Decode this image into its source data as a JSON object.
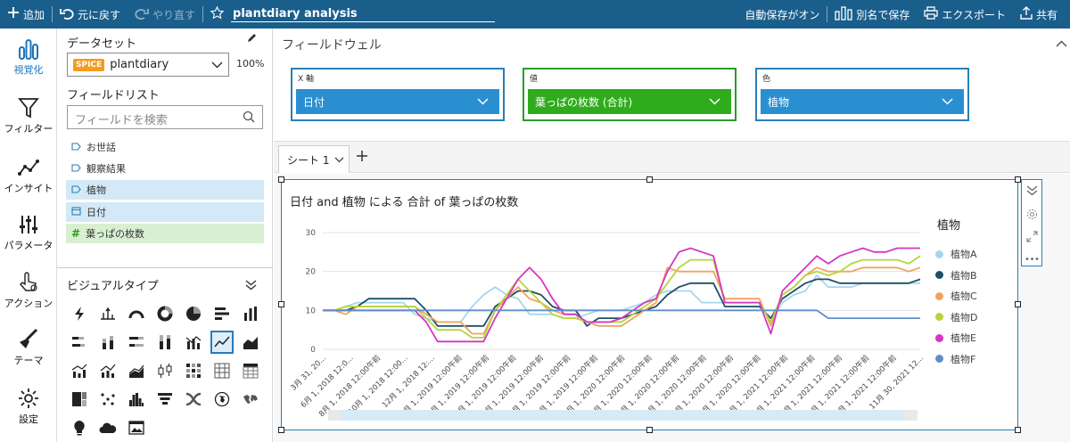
{
  "topbar": {
    "add_label": "追加",
    "undo_label": "元に戻す",
    "redo_label": "やり直す",
    "analysis_title": "plantdiary analysis",
    "autosave_label": "自動保存がオン",
    "save_as_label": "別名で保存",
    "export_label": "エクスポート",
    "share_label": "共有"
  },
  "rail": {
    "items": [
      {
        "label": "視覚化",
        "icon": "visualize-icon"
      },
      {
        "label": "フィルター",
        "icon": "filter-icon"
      },
      {
        "label": "インサイト",
        "icon": "insight-icon"
      },
      {
        "label": "パラメータ",
        "icon": "parameter-icon"
      },
      {
        "label": "アクション",
        "icon": "action-icon"
      },
      {
        "label": "テーマ",
        "icon": "theme-icon"
      },
      {
        "label": "設定",
        "icon": "settings-icon"
      }
    ]
  },
  "panel": {
    "dataset_heading": "データセット",
    "dataset_badge": "SPICE",
    "dataset_name": "plantdiary",
    "dataset_percent": "100%",
    "fieldlist_heading": "フィールドリスト",
    "search_placeholder": "フィールドを検索",
    "fields": [
      {
        "label": "お世話",
        "type": "dimension",
        "state": "none"
      },
      {
        "label": "観察結果",
        "type": "dimension",
        "state": "none"
      },
      {
        "label": "植物",
        "type": "dimension",
        "state": "selected"
      },
      {
        "label": "日付",
        "type": "date",
        "state": "selected"
      },
      {
        "label": "葉っぱの枚数",
        "type": "measure",
        "state": "measure-selected"
      }
    ],
    "visual_types_heading": "ビジュアルタイプ"
  },
  "field_wells": {
    "title": "フィールドウェル",
    "wells": [
      {
        "label": "X 軸",
        "value": "日付"
      },
      {
        "label": "値",
        "value": "葉っぱの枚数 (合計)"
      },
      {
        "label": "色",
        "value": "植物"
      }
    ]
  },
  "sheets": {
    "tabs": [
      {
        "label": "シート 1"
      }
    ]
  },
  "visual": {
    "title": "日付 and 植物 による 合計 of 葉っぱの枚数"
  },
  "chart_data": {
    "type": "line",
    "title": "日付 and 植物 による 合計 of 葉っぱの枚数",
    "legend_title": "植物",
    "legend_position": "right",
    "grid": "horizontal",
    "ylim": [
      0,
      30
    ],
    "yticks": [
      0,
      10,
      20,
      30
    ],
    "x_tick_labels": [
      "3月 31, 20...",
      "6月 1, 2018 12:0...",
      "8月 1, 2018 12:00午前",
      "10月 1, 2018 12:00...",
      "12月 1, 2018 12:...",
      "2月 1, 2019 12:00午前",
      "4月 1, 2019 12:00午前",
      "6月 1, 2019 12:00午前",
      "8月 1, 2019 12:00午前",
      "10月 1, 2019 12:00午前",
      "12月 1, 2019 12:00午前",
      "2月 1, 2020 12:00午前",
      "4月 1, 2020 12:00午前",
      "6月 1, 2020 12:00午前",
      "8月 1, 2020 12:00午前",
      "10月 1, 2020 12:00午前",
      "12月 1, 2020 12:00午前",
      "2月 1, 2021 12:00午前",
      "4月 1, 2021 12:00午前",
      "6月 1, 2021 12:00午前",
      "8月 1, 2021 12:00午前",
      "10月 1, 2021 12:00午前",
      "11月 30, 2021 12..."
    ],
    "series": [
      {
        "name": "植物A",
        "color": "#a6d6ec",
        "values": [
          10,
          10,
          11,
          12,
          12,
          12,
          12,
          12,
          9,
          8,
          7,
          7,
          7,
          11,
          14,
          16,
          14,
          13,
          9,
          9,
          9,
          8,
          8,
          9,
          10,
          10,
          10,
          11,
          12,
          14,
          15,
          15,
          15,
          12,
          12,
          12,
          12,
          12,
          12,
          7,
          12,
          14,
          15,
          19,
          16,
          16,
          16,
          17,
          17,
          17,
          17,
          17,
          17
        ]
      },
      {
        "name": "植物B",
        "color": "#1f4e66",
        "values": [
          10,
          10,
          10,
          11,
          13,
          13,
          13,
          13,
          13,
          10,
          6,
          6,
          6,
          6,
          6,
          11,
          13,
          15,
          15,
          14,
          11,
          10,
          10,
          6,
          8,
          8,
          8,
          9,
          10,
          11,
          14,
          16,
          17,
          17,
          17,
          11,
          11,
          11,
          11,
          8,
          13,
          15,
          17,
          18,
          18,
          17,
          17,
          17,
          17,
          17,
          17,
          17,
          18
        ]
      },
      {
        "name": "植物C",
        "color": "#f0a35e",
        "values": [
          10,
          10,
          9,
          11,
          11,
          11,
          11,
          11,
          11,
          9,
          7,
          7,
          7,
          4,
          4,
          10,
          13,
          16,
          13,
          12,
          10,
          9,
          9,
          7,
          6,
          6,
          6,
          8,
          10,
          12,
          21,
          20,
          20,
          20,
          20,
          13,
          13,
          13,
          13,
          6,
          14,
          16,
          19,
          21,
          20,
          20,
          20,
          21,
          21,
          21,
          21,
          20,
          21
        ]
      },
      {
        "name": "植物D",
        "color": "#b4d63a",
        "values": [
          10,
          10,
          11,
          11,
          11,
          11,
          11,
          11,
          11,
          8,
          5,
          5,
          5,
          3,
          3,
          10,
          14,
          18,
          15,
          12,
          9,
          8,
          8,
          7,
          7,
          7,
          7,
          9,
          11,
          13,
          17,
          21,
          23,
          23,
          23,
          12,
          12,
          12,
          12,
          7,
          14,
          16,
          19,
          20,
          19,
          20,
          22,
          23,
          23,
          23,
          23,
          22,
          24
        ]
      },
      {
        "name": "植物E",
        "color": "#d735c3",
        "values": [
          10,
          10,
          10,
          10,
          10,
          10,
          10,
          10,
          10,
          7,
          2,
          2,
          2,
          2,
          2,
          8,
          13,
          18,
          21,
          18,
          13,
          9,
          9,
          7,
          7,
          7,
          8,
          10,
          12,
          13,
          20,
          25,
          26,
          25,
          24,
          12,
          12,
          12,
          12,
          4,
          15,
          18,
          21,
          24,
          22,
          24,
          25,
          26,
          25,
          25,
          26,
          26,
          26
        ]
      },
      {
        "name": "植物F",
        "color": "#5f8fc7",
        "values": [
          10,
          10,
          10,
          10,
          10,
          10,
          10,
          10,
          10,
          10,
          10,
          10,
          10,
          10,
          10,
          10,
          10,
          10,
          10,
          10,
          10,
          10,
          10,
          10,
          10,
          10,
          10,
          10,
          10,
          10,
          10,
          10,
          10,
          10,
          10,
          10,
          10,
          10,
          10,
          10,
          10,
          10,
          10,
          10,
          8,
          8,
          8,
          8,
          8,
          8,
          8,
          8,
          8
        ]
      }
    ]
  },
  "colors": {
    "topbar": "#1a5e8c",
    "accent": "#1b73b8",
    "well_blue": "#2a8fd1",
    "well_green": "#2eac1c",
    "spice": "#f29c21"
  }
}
